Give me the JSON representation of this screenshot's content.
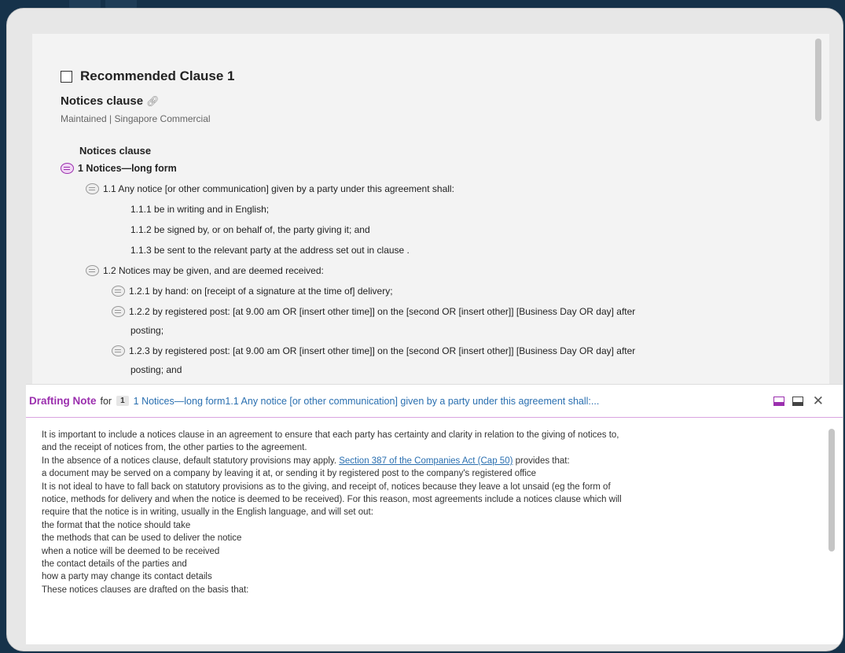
{
  "recommended_clause": {
    "title": "Recommended Clause 1",
    "clause_name": "Notices clause",
    "meta": "Maintained | Singapore Commercial"
  },
  "document": {
    "heading": "Notices clause",
    "lines": [
      "1 Notices—long form",
      "1.1 Any notice [or other communication] given by a party under this agreement shall:",
      "1.1.1 be in writing and in English;",
      "1.1.2 be signed by, or on behalf of, the party giving it; and",
      "1.1.3 be sent to the relevant party at the address set out in clause .",
      "1.2 Notices may be given, and are deemed received:",
      "1.2.1 by hand: on [receipt of a signature at the time of] delivery;",
      "1.2.2 by registered post: [at 9.00 am OR [insert other time]] on the [second OR [insert other]] [Business Day OR day] after",
      "posting;",
      "1.2.3 by registered post: [at 9.00 am OR [insert other time]] on the [second OR [insert other]] [Business Day OR day] after",
      "posting; and"
    ]
  },
  "drafting_note": {
    "title": "Drafting Note",
    "for_label": "for",
    "badge": "1",
    "reference": "1 Notices—long form1.1 Any notice [or other communication] given by a party under this agreement shall:...",
    "body": {
      "p1a": "It is important to include a notices clause in an agreement to ensure that each party has certainty and clarity in relation to the giving of notices to,",
      "p1b": "and the receipt of notices from, the other parties to the agreement.",
      "p2_pre": "In the absence of a notices clause, default statutory provisions may apply. ",
      "p2_link": "Section 387 of the Companies Act (Cap 50)",
      "p2_post": " provides that:",
      "p3": "a document may be served on a company by leaving it at, or sending it by registered post to the company's registered office",
      "p4a": "It is not ideal to have to fall back on statutory provisions as to the giving, and receipt of, notices because they leave a lot unsaid (eg the form of",
      "p4b": "notice, methods for delivery and when the notice is deemed to be received). For this reason, most agreements include a notices clause which will",
      "p4c": "require that the notice is in writing, usually in the English language, and will set out:",
      "l1": "the format that the notice should take",
      "l2": "the methods that can be used to deliver the notice",
      "l3": "when a notice will be deemed to be received",
      "l4": "the contact details of the parties and",
      "l5": "how a party may change its contact details",
      "p5": "These notices clauses are drafted on the basis that:"
    }
  },
  "icons": {
    "clause_comment": "speech-bubble-icon",
    "link": "link-icon",
    "dock_bottom": "dock-bottom-icon",
    "minimize": "minimize-panel-icon",
    "close": "close-icon"
  },
  "colors": {
    "accent_purple": "#9b2fae",
    "link_blue": "#2a6fb0",
    "background_navy": "#16324a"
  }
}
